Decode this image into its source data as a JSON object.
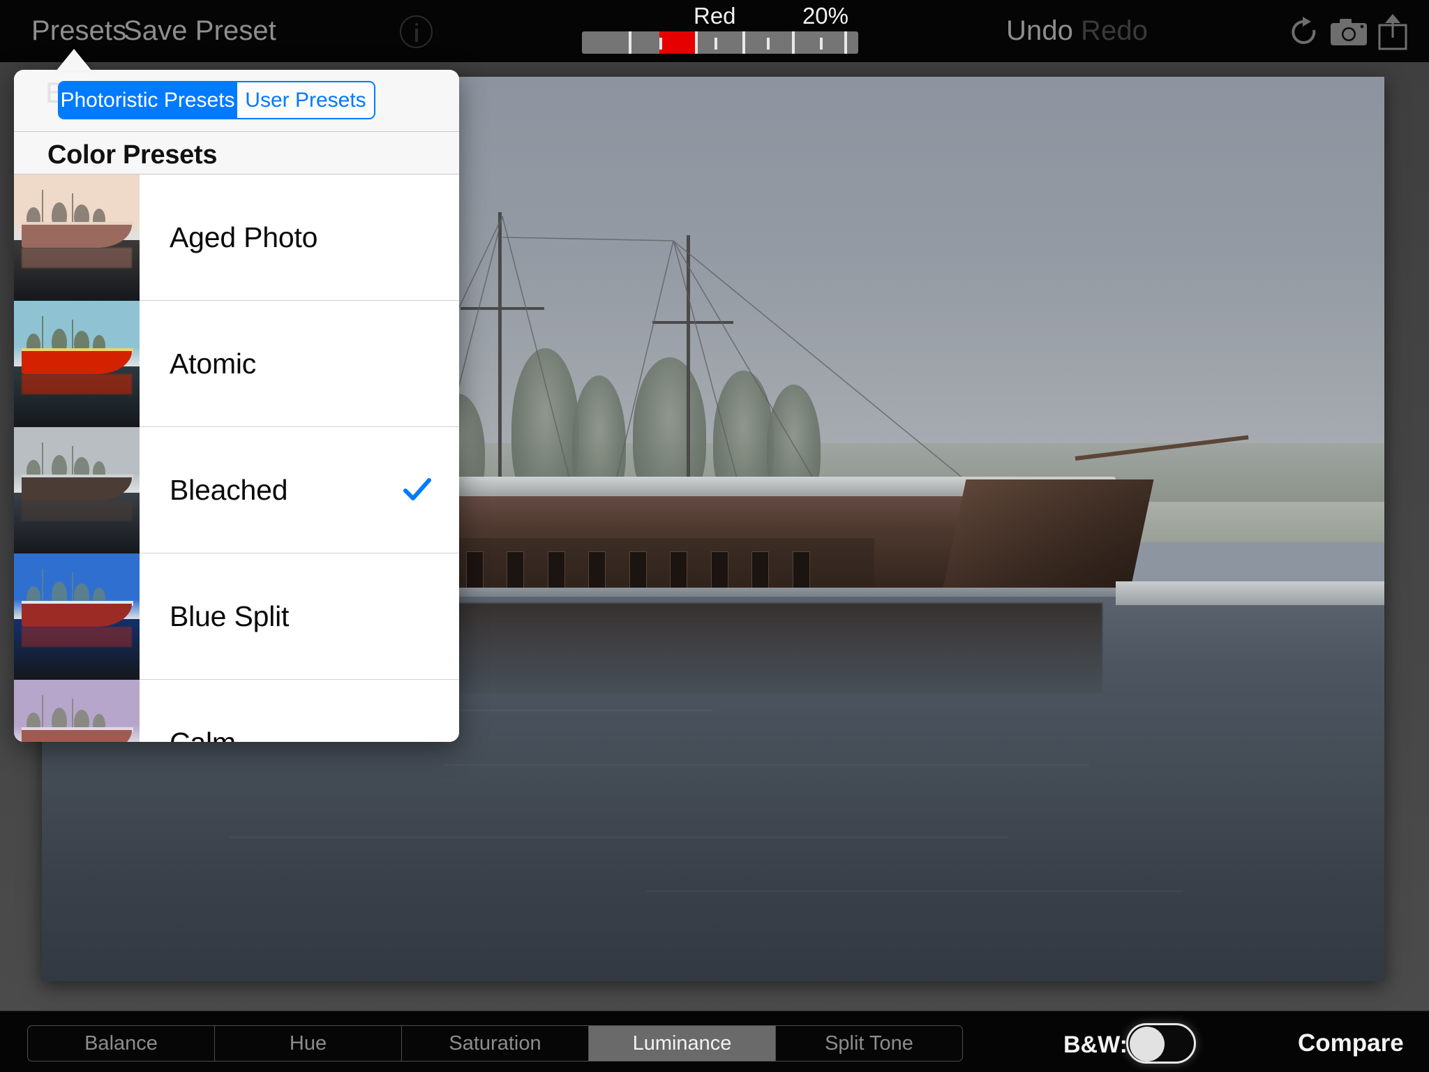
{
  "app": {
    "accent_blue": "#007aff",
    "slider_red": "#e60000"
  },
  "topbar": {
    "presets_label": "Presets",
    "save_preset_label": "Save Preset",
    "info_icon": "info-circle-icon",
    "undo_label": "Undo",
    "redo_label": "Redo",
    "rotate_icon": "rotate-right-icon",
    "camera_icon": "camera-icon",
    "share_icon": "share-export-icon",
    "slider": {
      "label": "Red",
      "value": "20%",
      "fill_start_pct": 28,
      "fill_width_pct": 13,
      "ticks_major_pct": [
        17,
        41,
        58,
        76,
        95
      ],
      "ticks_minor_pct": [
        28,
        48,
        67,
        86
      ]
    }
  },
  "popover": {
    "ghost_title": "B&W Tonal Presets",
    "tabs": [
      {
        "label": "Photoristic Presets",
        "selected": true
      },
      {
        "label": "User Presets",
        "selected": false
      }
    ],
    "section_header": "Color Presets",
    "presets": [
      {
        "name": "Aged Photo",
        "selected": false,
        "thumb": {
          "sky": "#efd9c8",
          "water": "#3c3a38",
          "boat": "#9a6a5e",
          "deck": "#e8d4c6",
          "tree": "#8d8278"
        }
      },
      {
        "name": "Atomic",
        "selected": false,
        "thumb": {
          "sky": "#8fc3d4",
          "water": "#2b3a40",
          "boat": "#d32200",
          "deck": "#f0d070",
          "tree": "#6d7f6a"
        }
      },
      {
        "name": "Bleached",
        "selected": true,
        "thumb": {
          "sky": "#b9bec2",
          "water": "#3a4048",
          "boat": "#4b3d36",
          "deck": "#cfd2d4",
          "tree": "#7d857c"
        }
      },
      {
        "name": "Blue Split",
        "selected": false,
        "thumb": {
          "sky": "#2f6fd0",
          "water": "#12306a",
          "boat": "#9c2b26",
          "deck": "#dfe6ef",
          "tree": "#5a7f8e"
        }
      },
      {
        "name": "Calm",
        "selected": false,
        "thumb": {
          "sky": "#b6a6cb",
          "water": "#4a4256",
          "boat": "#a05a50",
          "deck": "#e4d9e6",
          "tree": "#8a8a84"
        }
      }
    ]
  },
  "bottombar": {
    "segments": [
      {
        "label": "Balance",
        "selected": false
      },
      {
        "label": "Hue",
        "selected": false
      },
      {
        "label": "Saturation",
        "selected": false
      },
      {
        "label": "Luminance",
        "selected": true
      },
      {
        "label": "Split Tone",
        "selected": false
      }
    ],
    "bw_label": "B&W:",
    "bw_toggle_state": "off",
    "compare_label": "Compare"
  }
}
